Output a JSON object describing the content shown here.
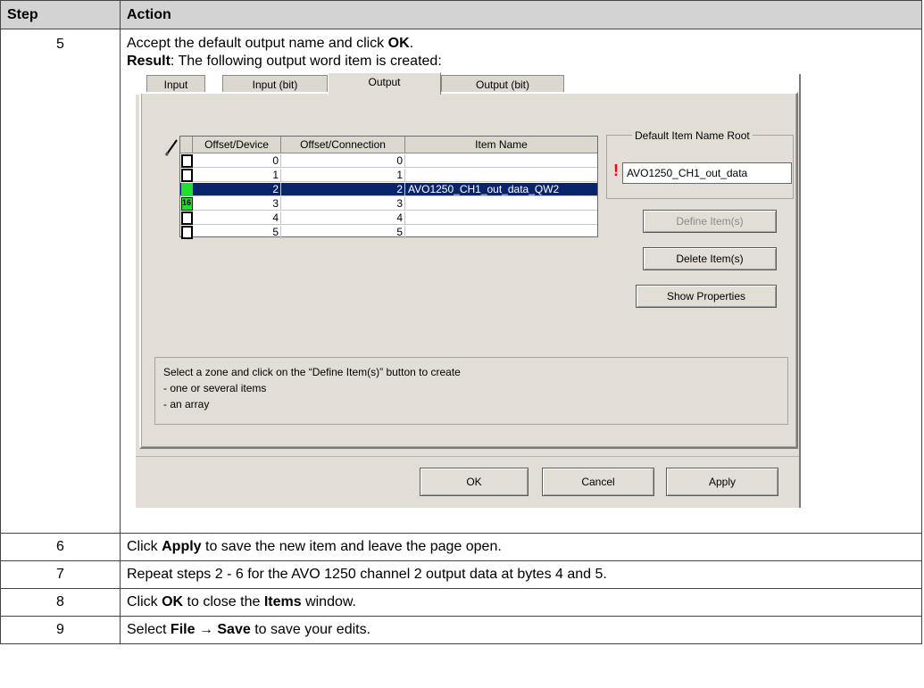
{
  "table": {
    "headers": {
      "step": "Step",
      "action": "Action"
    },
    "rows": [
      {
        "step": "5",
        "line1": {
          "text": "Accept the default output name and click ",
          "bold": "OK",
          "end": "."
        },
        "line2": {
          "bold": "Result",
          "text": ": The following output word item is created:"
        }
      },
      {
        "step": "6",
        "pre": "Click ",
        "bold": "Apply",
        "post": " to save the new item and leave the page open."
      },
      {
        "step": "7",
        "text": "Repeat steps 2 - 6 for the AVO 1250 channel 2 output data at bytes 4 and 5."
      },
      {
        "step": "8",
        "pre": "Click ",
        "bold": "OK",
        "mid": " to close the ",
        "bold2": "Items",
        "post": " window."
      },
      {
        "step": "9",
        "pre": "Select ",
        "bold": "File → Save",
        "post": " to save your edits."
      }
    ]
  },
  "dialog": {
    "tabs": [
      "Input",
      "Input (bit)",
      "Output",
      "Output (bit)"
    ],
    "active_tab": "Output",
    "grid": {
      "headers": [
        "Offset/Device",
        "Offset/Connection",
        "Item Name"
      ],
      "rows": [
        {
          "device": "0",
          "connection": "0",
          "name": ""
        },
        {
          "device": "1",
          "connection": "1",
          "name": ""
        },
        {
          "device": "2",
          "connection": "2",
          "name": "AVO1250_CH1_out_data_QW2"
        },
        {
          "device": "3",
          "connection": "3",
          "name": ""
        },
        {
          "device": "4",
          "connection": "4",
          "name": ""
        },
        {
          "device": "5",
          "connection": "5",
          "name": ""
        }
      ],
      "marker_label": "16"
    },
    "default_name": {
      "legend": "Default Item Name Root",
      "warning": "!",
      "value": "AVO1250_CH1_out_data"
    },
    "buttons": {
      "define": "Define Item(s)",
      "delete": "Delete Item(s)",
      "properties": "Show Properties",
      "ok": "OK",
      "cancel": "Cancel",
      "apply": "Apply"
    },
    "info": {
      "line1": "Select a zone and click on the “Define Item(s)” button to create",
      "line2": "- one or several items",
      "line3": "- an array"
    }
  },
  "colors": {
    "header_bg": "#d3d3d3",
    "dialog_bg": "#e2ded6",
    "selection": "#0a246a",
    "marker_green": "#1fe02a",
    "warning": "#ff0000"
  }
}
